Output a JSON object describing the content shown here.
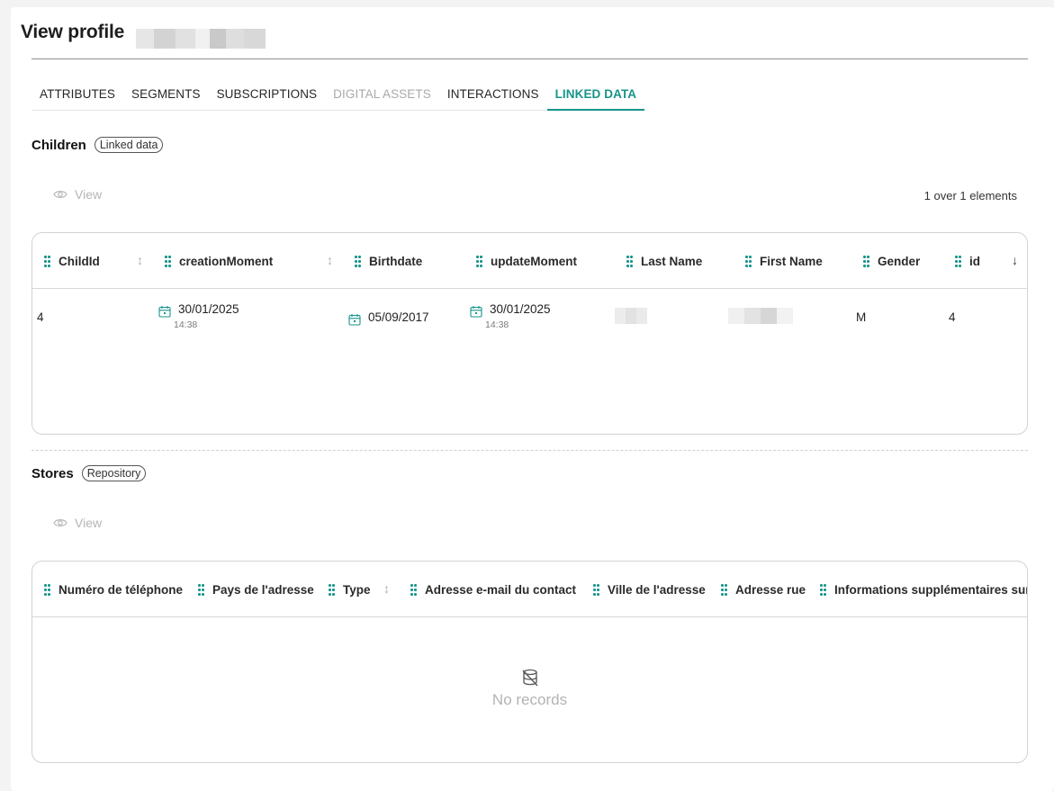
{
  "page": {
    "title": "View profile"
  },
  "tabs": [
    {
      "label": "ATTRIBUTES",
      "state": "normal"
    },
    {
      "label": "SEGMENTS",
      "state": "normal"
    },
    {
      "label": "SUBSCRIPTIONS",
      "state": "normal"
    },
    {
      "label": "DIGITAL ASSETS",
      "state": "disabled"
    },
    {
      "label": "INTERACTIONS",
      "state": "normal"
    },
    {
      "label": "LINKED DATA",
      "state": "active"
    }
  ],
  "children": {
    "title": "Children",
    "badge": "Linked data",
    "view_label": "View",
    "count_text": "1 over 1 elements",
    "columns": [
      "ChildId",
      "creationMoment",
      "Birthdate",
      "updateMoment",
      "Last Name",
      "First Name",
      "Gender",
      "id"
    ],
    "row": {
      "child_id": "4",
      "creation_date": "30/01/2025",
      "creation_time": "14:38",
      "birthdate": "05/09/2017",
      "update_date": "30/01/2025",
      "update_time": "14:38",
      "gender": "M",
      "id": "4"
    }
  },
  "stores": {
    "title": "Stores",
    "badge": "Repository",
    "view_label": "View",
    "columns": [
      "Numéro de téléphone",
      "Pays de l'adresse",
      "Type",
      "Adresse e-mail du contact",
      "Ville de l'adresse",
      "Adresse rue",
      "Informations supplémentaires sur"
    ],
    "empty_text": "No records"
  },
  "colors": {
    "accent": "#16948b",
    "muted": "#b3b3b3"
  },
  "icons": [
    "eye-icon",
    "drag-handle-icon",
    "sort-icon",
    "sort-desc-icon",
    "calendar-icon",
    "no-records-icon"
  ]
}
